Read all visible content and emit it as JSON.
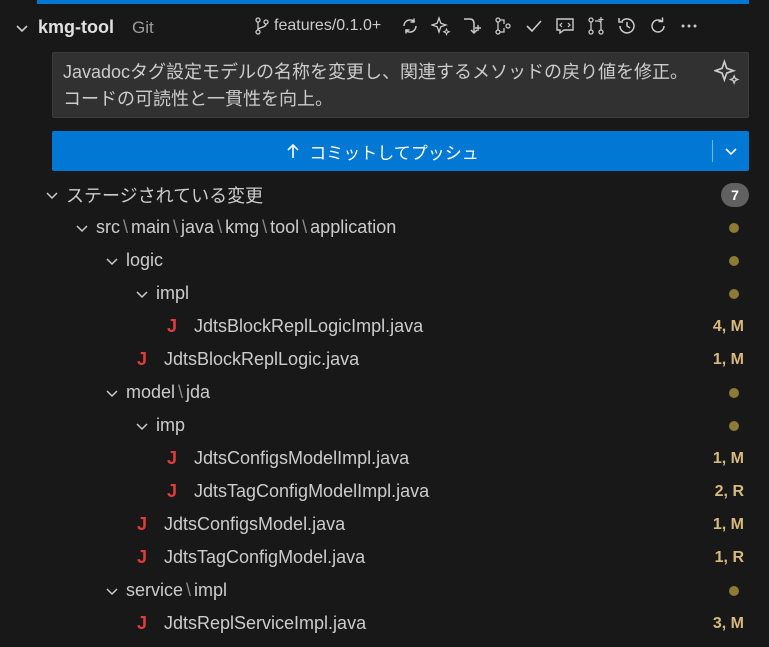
{
  "header": {
    "repo_name": "kmg-tool",
    "repo_type": "Git",
    "branch": "features/0.1.0+"
  },
  "toolbar": {
    "icons": [
      "sync-icon",
      "sparkle-icon",
      "pull-icon",
      "branch-compare-icon",
      "check-icon",
      "comment-icon",
      "pull-request-icon",
      "history-icon",
      "refresh-icon",
      "more-icon"
    ]
  },
  "commit_message": {
    "value": "Javadocタグ設定モデルの名称を変更し、関連するメソッドの戻り値を修正。コードの可読性と一貫性を向上。"
  },
  "commit_button": {
    "label": "コミットしてプッシュ"
  },
  "staged": {
    "label": "ステージされている変更",
    "count": "7"
  },
  "tree": {
    "root_path": [
      "src",
      "main",
      "java",
      "kmg",
      "tool",
      "application"
    ],
    "logic": "logic",
    "impl": "impl",
    "file1": {
      "name": "JdtsBlockReplLogicImpl.java",
      "status": "4, M"
    },
    "file2": {
      "name": "JdtsBlockReplLogic.java",
      "status": "1, M"
    },
    "model_path": [
      "model",
      "jda"
    ],
    "imp": "imp",
    "file3": {
      "name": "JdtsConfigsModelImpl.java",
      "status": "1, M"
    },
    "file4": {
      "name": "JdtsTagConfigModelImpl.java",
      "status": "2, R"
    },
    "file5": {
      "name": "JdtsConfigsModel.java",
      "status": "1, M"
    },
    "file6": {
      "name": "JdtsTagConfigModel.java",
      "status": "1, R"
    },
    "service_path": [
      "service",
      "impl"
    ],
    "file7": {
      "name": "JdtsReplServiceImpl.java",
      "status": "3, M"
    },
    "java_icon_glyph": "J"
  },
  "colors": {
    "accent": "#0078d4",
    "java": "#e03c3c",
    "modified": "#d7ba7d"
  }
}
